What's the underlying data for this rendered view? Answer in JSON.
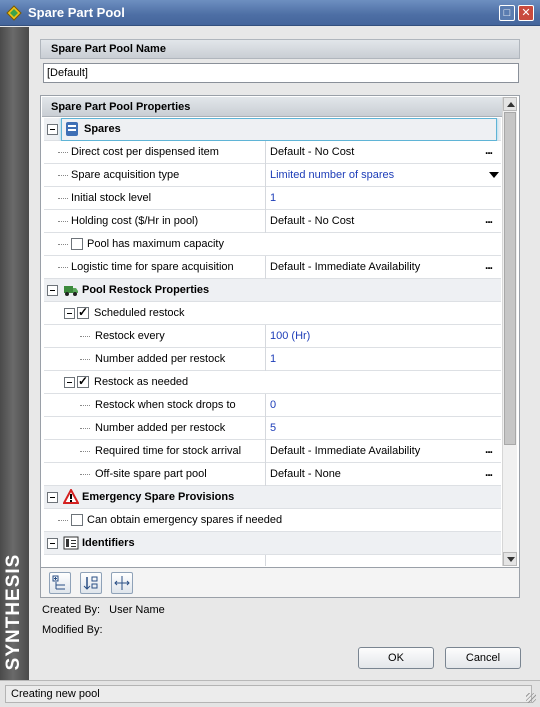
{
  "window": {
    "title": "Spare Part Pool",
    "brand": "SYNTHESIS"
  },
  "name_section": {
    "header": "Spare Part Pool Name",
    "value": "[Default]"
  },
  "properties": {
    "header": "Spare Part Pool Properties",
    "spares": {
      "label": "Spares",
      "direct_cost": {
        "label": "Direct cost per dispensed item",
        "value": "Default - No Cost"
      },
      "acquisition_type": {
        "label": "Spare acquisition type",
        "value": "Limited number of spares"
      },
      "initial_stock": {
        "label": "Initial stock level",
        "value": "1"
      },
      "holding_cost": {
        "label": "Holding cost ($/Hr in pool)",
        "value": "Default - No Cost"
      },
      "max_capacity": {
        "label": "Pool has maximum capacity"
      },
      "logistic_time": {
        "label": "Logistic time for spare acquisition",
        "value": "Default - Immediate Availability"
      }
    },
    "restock": {
      "label": "Pool Restock Properties",
      "scheduled": {
        "label": "Scheduled restock"
      },
      "restock_every": {
        "label": "Restock every",
        "value": "100 (Hr)"
      },
      "number_added_scheduled": {
        "label": "Number added per restock",
        "value": "1"
      },
      "as_needed": {
        "label": "Restock as needed"
      },
      "stock_drops_to": {
        "label": "Restock when stock drops to",
        "value": "0"
      },
      "number_added_needed": {
        "label": "Number added per restock",
        "value": "5"
      },
      "required_time": {
        "label": "Required time for stock arrival",
        "value": "Default - Immediate Availability"
      },
      "offsite_pool": {
        "label": "Off-site spare part pool",
        "value": "Default - None"
      }
    },
    "emergency": {
      "label": "Emergency Spare Provisions",
      "can_obtain": {
        "label": "Can obtain emergency spares if needed"
      }
    },
    "identifiers": {
      "label": "Identifiers"
    },
    "ellipsis": "..."
  },
  "meta": {
    "created_label": "Created By:",
    "created_value": "User Name",
    "modified_label": "Modified By:",
    "modified_value": ""
  },
  "buttons": {
    "ok": "OK",
    "cancel": "Cancel"
  },
  "status": {
    "text": "Creating new pool"
  },
  "icons": {
    "app": "synthesis-diamond-icon",
    "spares": "spares-stack-icon",
    "restock": "truck-icon",
    "emergency": "warning-triangle-icon",
    "identifiers": "id-card-icon",
    "toolbar": [
      "expand-all-icon",
      "sort-icon",
      "fit-columns-icon"
    ]
  },
  "colors": {
    "value_link": "#1d3db8",
    "title_bar": "#4d6ea4",
    "selection": "#5fb4d6"
  }
}
